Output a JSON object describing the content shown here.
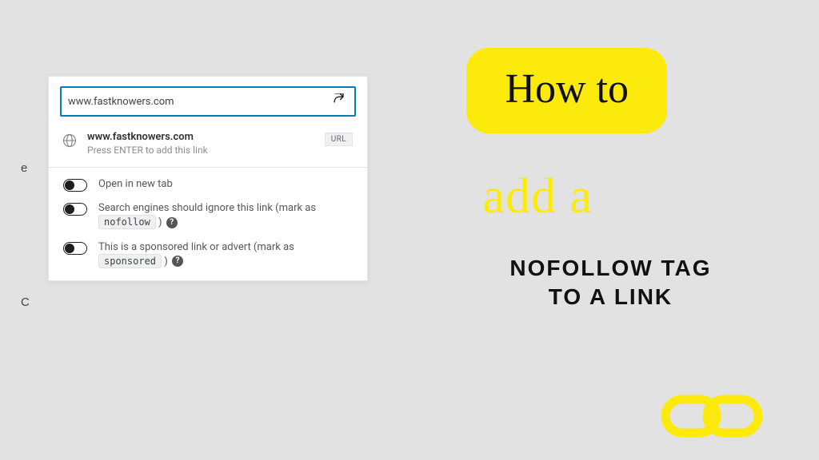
{
  "colors": {
    "accent": "#fcea0d",
    "input_border": "#007cba"
  },
  "edge": {
    "e": "e",
    "c": "C"
  },
  "link_dialog": {
    "input_value": "www.fastknowers.com",
    "suggestion": {
      "title": "www.fastknowers.com",
      "hint": "Press ENTER to add this link",
      "badge": "URL"
    },
    "options": {
      "new_tab": "Open in new tab",
      "nofollow_prefix": "Search engines should ignore this link (mark as",
      "nofollow_code": "nofollow",
      "nofollow_suffix": ")",
      "sponsored_prefix": "This is a sponsored link or advert (mark as",
      "sponsored_code": "sponsored",
      "sponsored_suffix": ")",
      "help_glyph": "?"
    }
  },
  "headline": {
    "line1": "How to",
    "line2": "add a",
    "sub_line1": "NOFOLLOW TAG",
    "sub_line2": "TO A LINK"
  }
}
